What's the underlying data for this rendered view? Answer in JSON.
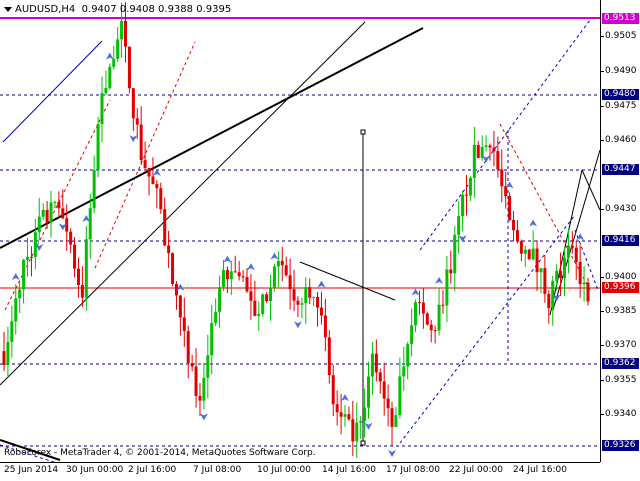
{
  "header": {
    "symbol_timeframe": "AUDUSD,H4",
    "ohlc": [
      "0.9407",
      "0.9408",
      "0.9388",
      "0.9395"
    ]
  },
  "footer": {
    "copyright": "RoboForex - MetaTrader 4, © 2001-2014, MetaQuotes Software Corp."
  },
  "colors": {
    "bull": "#00c000",
    "bear": "#e00000",
    "horizontal_level": "#000080",
    "bid_line": "#e00000",
    "current_price_label": "#e00000",
    "high_label": "#d000d0",
    "trendlines_red": "#e00000",
    "trendlines_blue": "#0000c0",
    "arrow_marker": "#4a6fe0"
  },
  "price_axis": {
    "ticks": [
      "0.9505",
      "0.9490",
      "0.9475",
      "0.9460",
      "0.9430",
      "0.9400",
      "0.9385",
      "0.9370",
      "0.9355",
      "0.9340"
    ],
    "labels": [
      {
        "text": "0.9513",
        "role": "high"
      },
      {
        "text": "0.9480",
        "role": "level"
      },
      {
        "text": "0.9447",
        "role": "level"
      },
      {
        "text": "0.9416",
        "role": "level"
      },
      {
        "text": "0.9396",
        "role": "current"
      },
      {
        "text": "0.9362",
        "role": "level"
      },
      {
        "text": "0.9326",
        "role": "level"
      }
    ]
  },
  "time_axis": {
    "labels": [
      "25 Jun 2014",
      "30 Jun 00:00",
      "2 Jul 16:00",
      "7 Jul 08:00",
      "10 Jul 00:00",
      "14 Jul 16:00",
      "17 Jul 08:00",
      "22 Jul 00:00",
      "24 Jul 16:00"
    ]
  },
  "chart_data": {
    "type": "candlestick",
    "symbol": "AUDUSD",
    "timeframe": "H4",
    "ylim": [
      0.932,
      0.952
    ],
    "horizontal_levels": [
      0.9513,
      0.948,
      0.9447,
      0.9416,
      0.9396,
      0.9362,
      0.9326
    ],
    "close_path": [
      {
        "x": "25 Jun 2014",
        "y": 0.9368
      },
      {
        "x": "26 Jun",
        "y": 0.9405
      },
      {
        "x": "27 Jun",
        "y": 0.9425
      },
      {
        "x": "29 Jun",
        "y": 0.943
      },
      {
        "x": "30 Jun 00:00",
        "y": 0.9392
      },
      {
        "x": "1 Jul",
        "y": 0.948
      },
      {
        "x": "1 Jul 12:00",
        "y": 0.9508
      },
      {
        "x": "2 Jul",
        "y": 0.9455
      },
      {
        "x": "2 Jul 16:00",
        "y": 0.943
      },
      {
        "x": "3 Jul",
        "y": 0.938
      },
      {
        "x": "4 Jul",
        "y": 0.9345
      },
      {
        "x": "7 Jul 08:00",
        "y": 0.9395
      },
      {
        "x": "8 Jul",
        "y": 0.9405
      },
      {
        "x": "9 Jul",
        "y": 0.9378
      },
      {
        "x": "10 Jul 00:00",
        "y": 0.9412
      },
      {
        "x": "11 Jul",
        "y": 0.9392
      },
      {
        "x": "14 Jul",
        "y": 0.9398
      },
      {
        "x": "14 Jul 16:00",
        "y": 0.934
      },
      {
        "x": "15 Jul",
        "y": 0.933
      },
      {
        "x": "16 Jul",
        "y": 0.9365
      },
      {
        "x": "17 Jul 08:00",
        "y": 0.9338
      },
      {
        "x": "18 Jul",
        "y": 0.9388
      },
      {
        "x": "21 Jul",
        "y": 0.9375
      },
      {
        "x": "22 Jul 00:00",
        "y": 0.9408
      },
      {
        "x": "22 Jul 12:00",
        "y": 0.945
      },
      {
        "x": "23 Jul",
        "y": 0.9462
      },
      {
        "x": "23 Jul 12:00",
        "y": 0.942
      },
      {
        "x": "24 Jul",
        "y": 0.9412
      },
      {
        "x": "24 Jul 16:00",
        "y": 0.9392
      },
      {
        "x": "25 Jul",
        "y": 0.941
      },
      {
        "x": "25 Jul 12:00",
        "y": 0.9395
      }
    ]
  }
}
